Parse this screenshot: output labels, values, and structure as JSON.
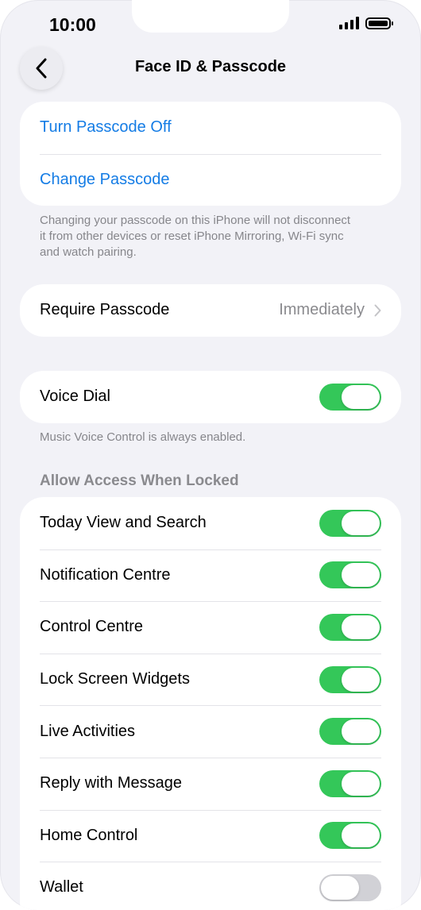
{
  "status_bar": {
    "time": "10:00"
  },
  "nav": {
    "title": "Face ID & Passcode"
  },
  "passcode_card": {
    "items": [
      {
        "label": "Turn Passcode Off"
      },
      {
        "label": "Change Passcode"
      }
    ],
    "footnote": "Changing your passcode on this iPhone will not disconnect it from other devices or reset iPhone Mirroring, Wi-Fi sync and watch pairing."
  },
  "require_passcode": {
    "label": "Require Passcode",
    "value": "Immediately"
  },
  "voice_dial": {
    "label": "Voice Dial",
    "state": "on",
    "footnote": "Music Voice Control is always enabled."
  },
  "allow_access": {
    "header": "Allow Access When Locked",
    "items": [
      {
        "label": "Today View and Search",
        "state": "on"
      },
      {
        "label": "Notification Centre",
        "state": "on"
      },
      {
        "label": "Control Centre",
        "state": "on"
      },
      {
        "label": "Lock Screen Widgets",
        "state": "on"
      },
      {
        "label": "Live Activities",
        "state": "on"
      },
      {
        "label": "Reply with Message",
        "state": "on"
      },
      {
        "label": "Home Control",
        "state": "on"
      },
      {
        "label": "Wallet",
        "state": "off"
      }
    ]
  },
  "colors": {
    "accent": "#147ce5",
    "toggle_on": "#34c759",
    "toggle_off": "#d1d1d6",
    "background": "#f2f2f7"
  },
  "icons": {
    "back": "chevron-left-icon",
    "disclosure": "chevron-right-icon",
    "signal": "cellular-signal-icon",
    "battery": "battery-icon"
  }
}
